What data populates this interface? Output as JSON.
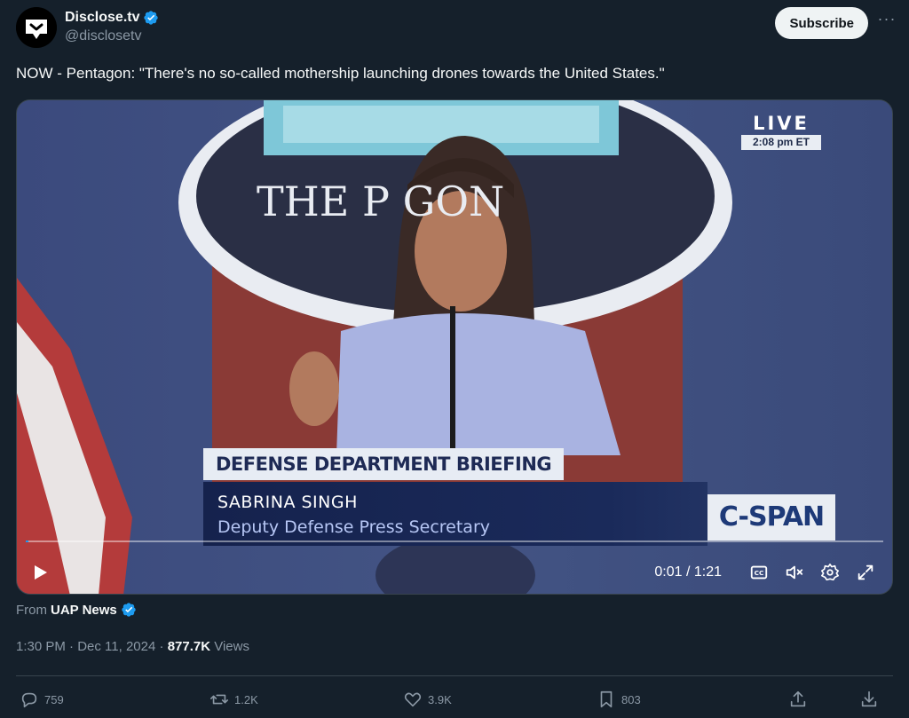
{
  "author": {
    "display_name": "Disclose.tv",
    "handle": "@disclosetv",
    "verified": true
  },
  "header": {
    "subscribe_label": "Subscribe",
    "more_icon": "more-icon"
  },
  "tweet": {
    "text": "NOW - Pentagon: \"There's no so-called mothership launching drones towards the United States.\""
  },
  "video": {
    "live_label": "LIVE",
    "live_time": "2:08 pm ET",
    "backdrop_text": "THE P   GON",
    "lower_third_title": "DEFENSE DEPARTMENT BRIEFING",
    "speaker_name": "SABRINA SINGH",
    "speaker_role": "Deputy Defense Press Secretary",
    "network_logo": "C-SPAN",
    "time_readout": "0:01 / 1:21",
    "progress_fraction": 0.0,
    "accent_color": "#1d9bf0"
  },
  "source": {
    "prefix": "From",
    "name": "UAP News",
    "verified": true
  },
  "meta": {
    "time": "1:30 PM",
    "date": "Dec 11, 2024",
    "views_count": "877.7K",
    "views_label": "Views"
  },
  "actions": {
    "replies": "759",
    "reposts": "1.2K",
    "likes": "3.9K",
    "bookmarks": "803"
  },
  "colors": {
    "background": "#15202b",
    "verified_blue": "#1d9bf0",
    "muted_text": "#8b98a5"
  }
}
